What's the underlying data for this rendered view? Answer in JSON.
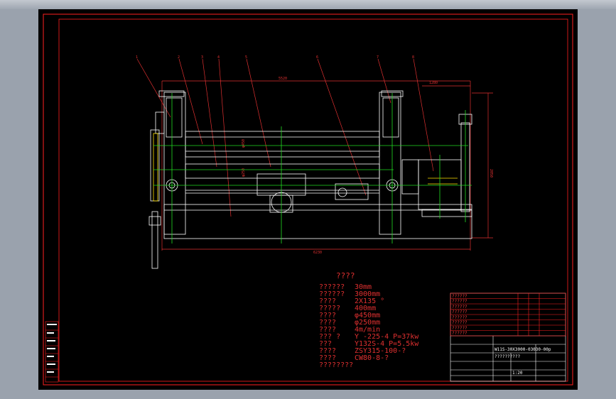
{
  "drawing": {
    "part_labels": [
      "1",
      "2",
      "3",
      "4",
      "5",
      "6",
      "7",
      "8"
    ],
    "dimensions": {
      "top_span": "5520",
      "top_right": "1280",
      "bottom_span": "6230",
      "right_height": "2050",
      "roll_dia_upper": "φ450",
      "roll_dia_lower": "φ250"
    }
  },
  "spec": {
    "title": "????",
    "rows": [
      {
        "key": "??????",
        "value": "30mm"
      },
      {
        "key": "??????",
        "value": "3000mm"
      },
      {
        "key": "????",
        "value": "2X135   °"
      },
      {
        "key": "?????",
        "value": "400mm"
      },
      {
        "key": "????",
        "value": "φ450mm"
      },
      {
        "key": "????",
        "value": "φ250mm"
      },
      {
        "key": "????",
        "value": "4m/min"
      },
      {
        "key": "???      ?",
        "value": "Y   -225-4    P=37kw"
      },
      {
        "key": "???",
        "value": "Y132S-4      P=5.5kw"
      },
      {
        "key": "????",
        "value": "ZSY315-100-?"
      },
      {
        "key": "????",
        "value": "CW80-8-?"
      }
    ],
    "note": "????????"
  },
  "title_block": {
    "drawing_no": "W11S-30X3000-03030-00p",
    "sub_title": "??????????",
    "scale": "1:20",
    "part_rows": [
      "??????",
      "??????",
      "??????",
      "??????",
      "??????",
      "??????",
      "??????",
      "??????"
    ]
  },
  "colors": {
    "sheet": "#000000",
    "border": "#ff2020",
    "machine": "#ffffff",
    "centerline": "#22dd22",
    "annotation": "#e03030",
    "background": "#9aa2ad"
  }
}
